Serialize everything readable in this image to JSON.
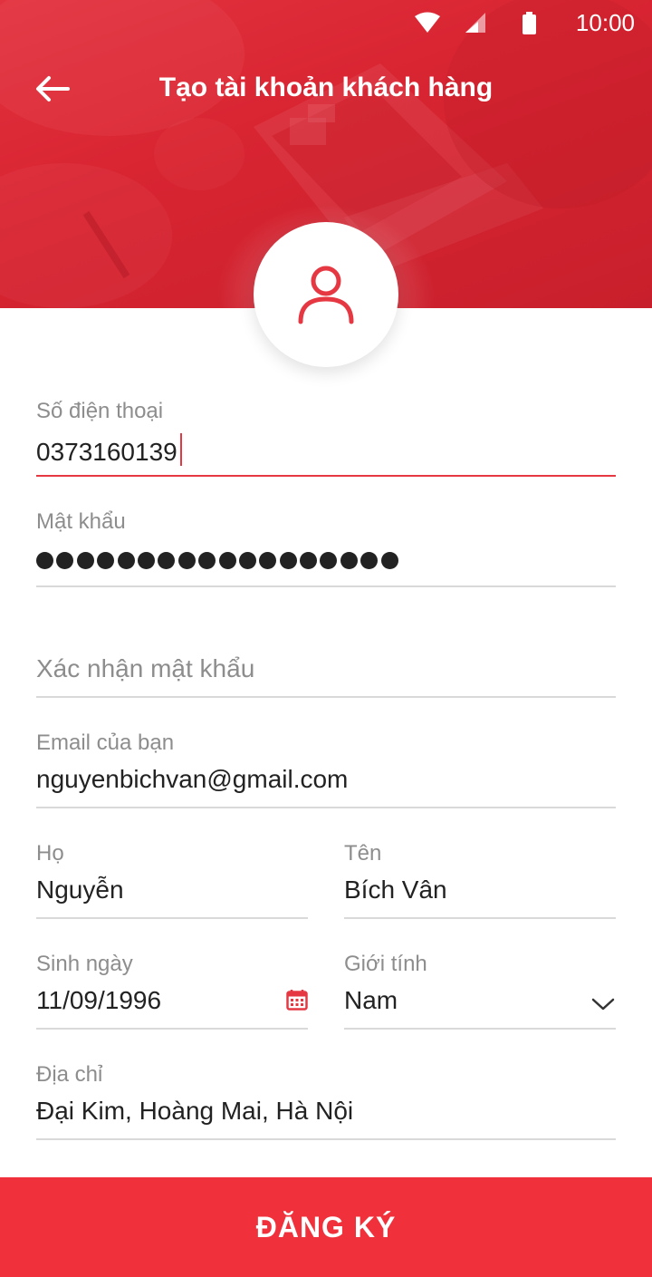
{
  "status_bar": {
    "time": "10:00"
  },
  "header": {
    "title": "Tạo tài khoản khách hàng"
  },
  "colors": {
    "accent": "#e53842",
    "button": "#f0313b",
    "hero": "#d92532"
  },
  "form": {
    "phone": {
      "label": "Số điện thoại",
      "value": "0373160139"
    },
    "password": {
      "label": "Mật khẩu",
      "dot_count": 18
    },
    "confirm_password": {
      "placeholder": "Xác nhận mật khẩu"
    },
    "email": {
      "label": "Email của bạn",
      "value": "nguyenbichvan@gmail.com"
    },
    "last_name": {
      "label": "Họ",
      "value": "Nguyễn"
    },
    "first_name": {
      "label": "Tên",
      "value": "Bích Vân"
    },
    "birthday": {
      "label": "Sinh ngày",
      "value": "11/09/1996"
    },
    "gender": {
      "label": "Giới tính",
      "value": "Nam"
    },
    "address": {
      "label": "Địa chỉ",
      "value": "Đại Kim, Hoàng Mai, Hà Nội"
    }
  },
  "submit_button": {
    "label": "ĐĂNG KÝ"
  }
}
